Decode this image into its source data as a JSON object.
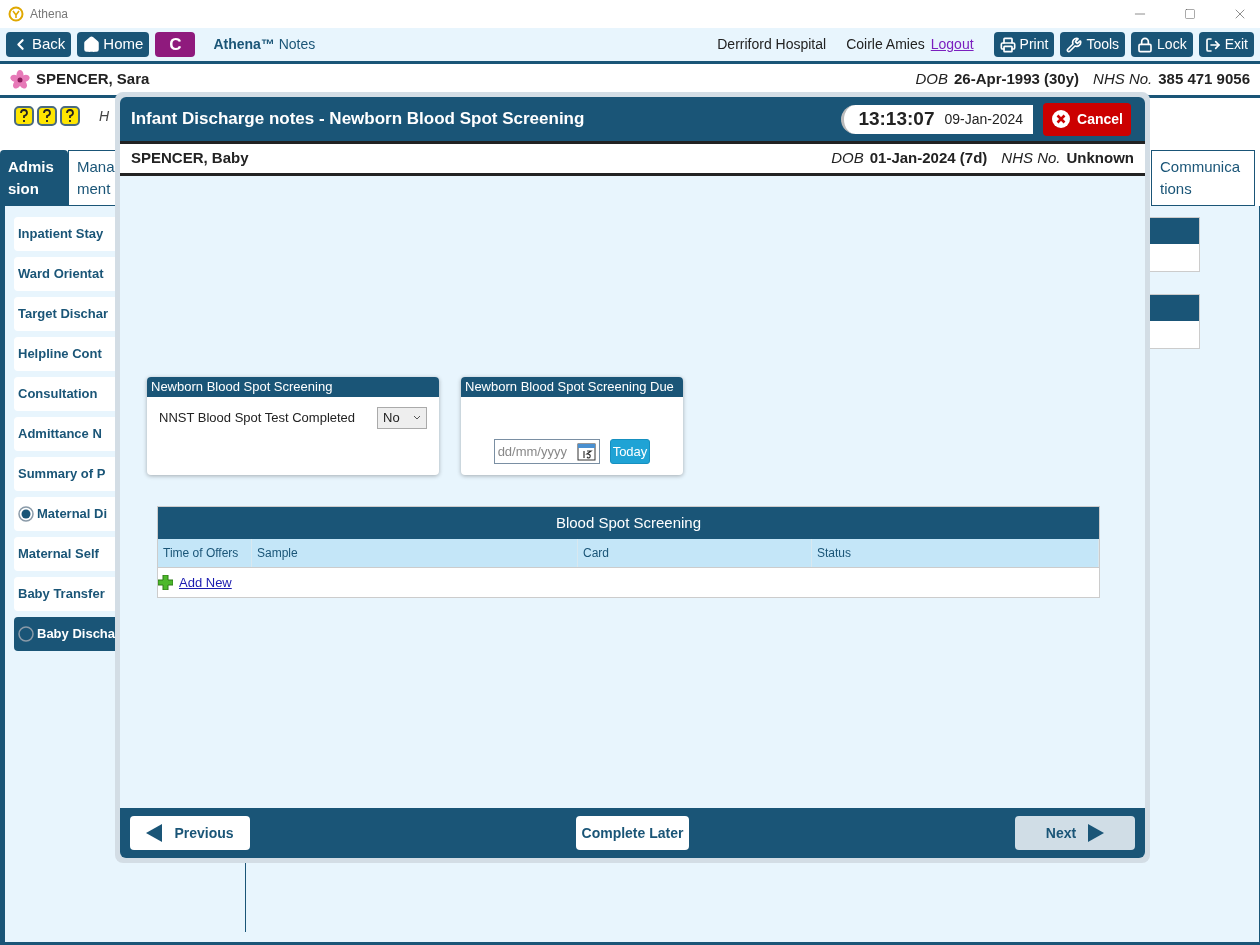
{
  "window": {
    "title": "Athena"
  },
  "toolbar": {
    "nav": [
      {
        "kind": "back",
        "label": "Back"
      },
      {
        "kind": "home",
        "label": "Home"
      }
    ],
    "badge": "C",
    "brand": "Athena™",
    "app": "Notes",
    "hospital": "Derriford Hospital",
    "user": "Coirle Amies",
    "logout": "Logout",
    "actions": [
      {
        "kind": "print",
        "label": "Print"
      },
      {
        "kind": "tools",
        "label": "Tools"
      },
      {
        "kind": "lock",
        "label": "Lock"
      },
      {
        "kind": "exit",
        "label": "Exit"
      }
    ]
  },
  "patient": {
    "name": "SPENCER, Sara",
    "dob_label": "DOB",
    "dob": "26-Apr-1993 (30y)",
    "nhs_label": "NHS No.",
    "nhs": "385 471 9056"
  },
  "note": "H",
  "tabs": [
    {
      "lines": [
        "Admis",
        "sion"
      ],
      "selected": true
    },
    {
      "lines": [
        "Mana",
        "ment"
      ],
      "selected": false
    },
    {
      "lines": [
        "Communica",
        "tions"
      ],
      "selected": false
    }
  ],
  "sidebar": {
    "items": [
      {
        "kind": "plain",
        "label": "Inpatient Stay",
        "selected": false
      },
      {
        "kind": "plain",
        "label": "Ward Orientat",
        "selected": false
      },
      {
        "kind": "plain",
        "label": "Target Dischar",
        "selected": false
      },
      {
        "kind": "plain",
        "label": "Helpline Cont",
        "selected": false
      },
      {
        "kind": "plain",
        "label": "Consultation",
        "selected": false
      },
      {
        "kind": "plain",
        "label": "Admittance N",
        "selected": false
      },
      {
        "kind": "plain",
        "label": "Summary of P",
        "selected": false
      },
      {
        "kind": "radio",
        "label": "Maternal Di",
        "selected": false,
        "checked": true
      },
      {
        "kind": "plain",
        "label": "Maternal Self",
        "selected": false
      },
      {
        "kind": "plain",
        "label": "Baby Transfer",
        "selected": false
      },
      {
        "kind": "radio",
        "label": "Baby Discha",
        "selected": true,
        "checked": false
      }
    ]
  },
  "modal": {
    "title": "Infant Discharge notes - Newborn Blood Spot Screening",
    "time": "13:13:07",
    "date": "09-Jan-2024",
    "cancel": "Cancel",
    "baby": {
      "name": "SPENCER, Baby",
      "dob_label": "DOB",
      "dob": "01-Jan-2024 (7d)",
      "nhs_label": "NHS No.",
      "nhs": "Unknown"
    },
    "panels": [
      {
        "kind": "select",
        "title": "Newborn Blood Spot Screening",
        "label": "NNST Blood Spot Test Completed",
        "value": "No"
      },
      {
        "kind": "date",
        "title": "Newborn Blood Spot Screening Due",
        "placeholder": "dd/mm/yyyy",
        "button": "Today"
      }
    ],
    "table": {
      "title": "Blood Spot Screening",
      "columns": [
        "Time of Offers",
        "Sample",
        "Card",
        "Status"
      ],
      "add_new": "Add New"
    },
    "footer": {
      "previous": {
        "label": "Previous",
        "disabled": false
      },
      "complete_later": {
        "label": "Complete Later",
        "disabled": false
      },
      "next": {
        "label": "Next",
        "disabled": true
      }
    }
  }
}
